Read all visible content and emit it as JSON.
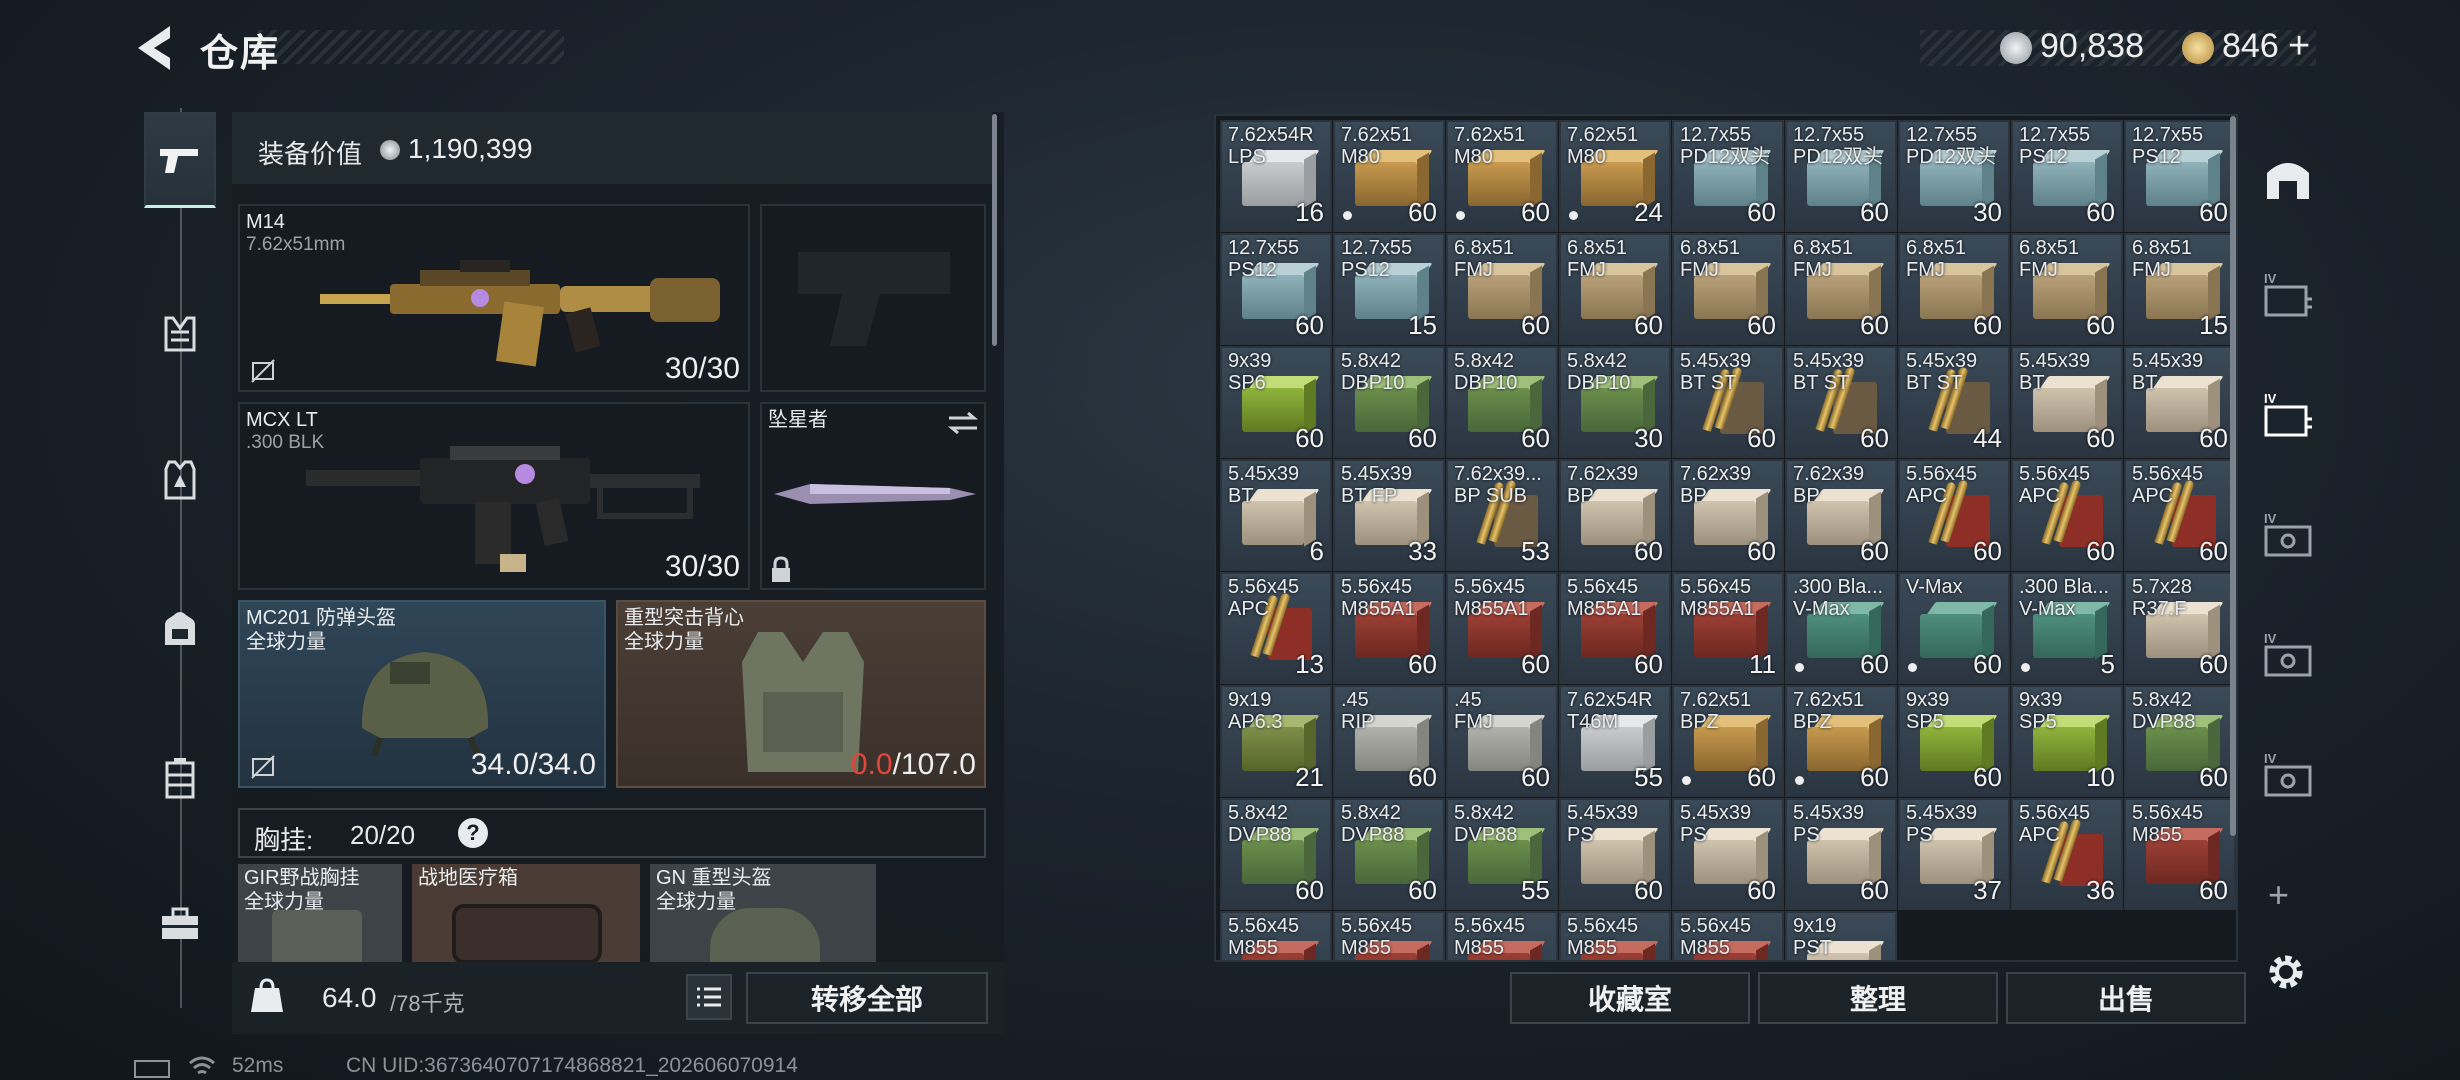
{
  "header": {
    "title": "仓库"
  },
  "currency": {
    "silver": "90,838",
    "gold": "846",
    "gold_add": "+"
  },
  "nav": [
    "pistol-icon",
    "vest-icon",
    "armor-icon",
    "backpack-icon",
    "container-icon",
    "toolbox-icon"
  ],
  "loadout": {
    "value_label": "装备价值",
    "value": "1,190,399",
    "primary": {
      "name": "M14",
      "caliber": "7.62x51mm",
      "ammo": "30/30"
    },
    "secondary": {
      "name": "MCX LT",
      "caliber": ".300 BLK",
      "ammo": "30/30"
    },
    "melee": {
      "name": "坠星者"
    },
    "helmet": {
      "name": "MC201 防弹头盔",
      "brand": "全球力量",
      "durability": "34.0/34.0"
    },
    "vest": {
      "name": "重型突击背心",
      "brand": "全球力量",
      "durability_cur": "0.0",
      "durability_max": "/107.0"
    },
    "rig": {
      "label": "胸挂:",
      "count": "20/20",
      "help": "?"
    },
    "rig_items": [
      {
        "name": "GIR野战胸挂",
        "brand": "全球力量"
      },
      {
        "name": "战地医疗箱",
        "brand": ""
      },
      {
        "name": "GN 重型头盔",
        "brand": "全球力量"
      }
    ],
    "weight": "64.0",
    "weight_max": "/78千克",
    "transfer_all": "转移全部"
  },
  "stash_items": [
    {
      "n": "7.62x54R\nLPS",
      "q": "16",
      "c": "white",
      "d": false
    },
    {
      "n": "7.62x51\nM80",
      "q": "60",
      "c": "tan",
      "d": true
    },
    {
      "n": "7.62x51\nM80",
      "q": "60",
      "c": "tan",
      "d": true
    },
    {
      "n": "7.62x51\nM80",
      "q": "24",
      "c": "tan",
      "d": true
    },
    {
      "n": "12.7x55\nPD12双头",
      "q": "60",
      "c": "blue",
      "d": false
    },
    {
      "n": "12.7x55\nPD12双头",
      "q": "60",
      "c": "blue",
      "d": false
    },
    {
      "n": "12.7x55\nPD12双头",
      "q": "30",
      "c": "blue",
      "d": false
    },
    {
      "n": "12.7x55\nPS12",
      "q": "60",
      "c": "blue",
      "d": false
    },
    {
      "n": "12.7x55\nPS12",
      "q": "60",
      "c": "blue",
      "d": false
    },
    {
      "n": "12.7x55\nPS12",
      "q": "60",
      "c": "blue",
      "d": false
    },
    {
      "n": "12.7x55\nPS12",
      "q": "15",
      "c": "blue",
      "d": false
    },
    {
      "n": "6.8x51\nFMJ",
      "q": "60",
      "c": "sand",
      "d": false
    },
    {
      "n": "6.8x51\nFMJ",
      "q": "60",
      "c": "sand",
      "d": false
    },
    {
      "n": "6.8x51\nFMJ",
      "q": "60",
      "c": "sand",
      "d": false
    },
    {
      "n": "6.8x51\nFMJ",
      "q": "60",
      "c": "sand",
      "d": false
    },
    {
      "n": "6.8x51\nFMJ",
      "q": "60",
      "c": "sand",
      "d": false
    },
    {
      "n": "6.8x51\nFMJ",
      "q": "60",
      "c": "sand",
      "d": false
    },
    {
      "n": "6.8x51\nFMJ",
      "q": "15",
      "c": "sand",
      "d": false
    },
    {
      "n": "9x39\nSP6",
      "q": "60",
      "c": "lime",
      "d": false
    },
    {
      "n": "5.8x42\nDBP10",
      "q": "60",
      "c": "green",
      "d": false
    },
    {
      "n": "5.8x42\nDBP10",
      "q": "60",
      "c": "green",
      "d": false
    },
    {
      "n": "5.8x42\nDBP10",
      "q": "30",
      "c": "green",
      "d": false
    },
    {
      "n": "5.45x39\nBT ST",
      "q": "60",
      "c": "bullet",
      "d": false
    },
    {
      "n": "5.45x39\nBT ST",
      "q": "60",
      "c": "bullet",
      "d": false
    },
    {
      "n": "5.45x39\nBT ST",
      "q": "44",
      "c": "bullet",
      "d": false
    },
    {
      "n": "5.45x39\nBT",
      "q": "60",
      "c": "beige",
      "d": false
    },
    {
      "n": "5.45x39\nBT",
      "q": "60",
      "c": "beige",
      "d": false
    },
    {
      "n": "5.45x39\nBT",
      "q": "6",
      "c": "beige",
      "d": false
    },
    {
      "n": "5.45x39\nBT FP",
      "q": "33",
      "c": "beige",
      "d": false
    },
    {
      "n": "7.62x39...\nBP SUB",
      "q": "53",
      "c": "bullet",
      "d": false
    },
    {
      "n": "7.62x39\nBP",
      "q": "60",
      "c": "beige",
      "d": false
    },
    {
      "n": "7.62x39\nBP",
      "q": "60",
      "c": "beige",
      "d": false
    },
    {
      "n": "7.62x39\nBP",
      "q": "60",
      "c": "beige",
      "d": false
    },
    {
      "n": "5.56x45\nAPC",
      "q": "60",
      "c": "redbullet",
      "d": false
    },
    {
      "n": "5.56x45\nAPC",
      "q": "60",
      "c": "redbullet",
      "d": false
    },
    {
      "n": "5.56x45\nAPC",
      "q": "60",
      "c": "redbullet",
      "d": false
    },
    {
      "n": "5.56x45\nAPC",
      "q": "13",
      "c": "redbullet",
      "d": false
    },
    {
      "n": "5.56x45\nM855A1",
      "q": "60",
      "c": "red",
      "d": false
    },
    {
      "n": "5.56x45\nM855A1",
      "q": "60",
      "c": "red",
      "d": false
    },
    {
      "n": "5.56x45\nM855A1",
      "q": "60",
      "c": "red",
      "d": false
    },
    {
      "n": "5.56x45\nM855A1",
      "q": "11",
      "c": "red",
      "d": false
    },
    {
      "n": ".300 Bla...\nV-Max",
      "q": "60",
      "c": "teal",
      "d": true
    },
    {
      "n": "V-Max",
      "q": "60",
      "c": "teal",
      "d": true
    },
    {
      "n": ".300 Bla...\nV-Max",
      "q": "5",
      "c": "teal",
      "d": true
    },
    {
      "n": "5.7x28\nR37.F",
      "q": "60",
      "c": "beige",
      "d": false
    },
    {
      "n": "9x19\nAP6.3",
      "q": "21",
      "c": "olive",
      "d": false
    },
    {
      "n": ".45\nRIP",
      "q": "60",
      "c": "grey",
      "d": false
    },
    {
      "n": ".45\nFMJ",
      "q": "60",
      "c": "grey",
      "d": false
    },
    {
      "n": "7.62x54R\nT46M",
      "q": "55",
      "c": "white",
      "d": false
    },
    {
      "n": "7.62x51\nBPZ",
      "q": "60",
      "c": "tan",
      "d": true
    },
    {
      "n": "7.62x51\nBPZ",
      "q": "60",
      "c": "tan",
      "d": true
    },
    {
      "n": "9x39\nSP5",
      "q": "60",
      "c": "lime",
      "d": false
    },
    {
      "n": "9x39\nSP5",
      "q": "10",
      "c": "lime",
      "d": false
    },
    {
      "n": "5.8x42\nDVP88",
      "q": "60",
      "c": "green",
      "d": false
    },
    {
      "n": "5.8x42\nDVP88",
      "q": "60",
      "c": "green",
      "d": false
    },
    {
      "n": "5.8x42\nDVP88",
      "q": "60",
      "c": "green",
      "d": false
    },
    {
      "n": "5.8x42\nDVP88",
      "q": "55",
      "c": "green",
      "d": false
    },
    {
      "n": "5.45x39\nPS",
      "q": "60",
      "c": "beige",
      "d": false
    },
    {
      "n": "5.45x39\nPS",
      "q": "60",
      "c": "beige",
      "d": false
    },
    {
      "n": "5.45x39\nPS",
      "q": "60",
      "c": "beige",
      "d": false
    },
    {
      "n": "5.45x39\nPS",
      "q": "37",
      "c": "beige",
      "d": false
    },
    {
      "n": "5.56x45\nAPC",
      "q": "36",
      "c": "redbullet",
      "d": false
    },
    {
      "n": "5.56x45\nM855",
      "q": "60",
      "c": "red",
      "d": false
    },
    {
      "n": "5.56x45\nM855",
      "q": "",
      "c": "red",
      "d": false
    },
    {
      "n": "5.56x45\nM855",
      "q": "",
      "c": "red",
      "d": false
    },
    {
      "n": "5.56x45\nM855",
      "q": "",
      "c": "red",
      "d": false
    },
    {
      "n": "5.56x45\nM855",
      "q": "",
      "c": "red",
      "d": false
    },
    {
      "n": "5.56x45\nM855",
      "q": "",
      "c": "red",
      "d": false
    },
    {
      "n": "9x19\nPST",
      "q": "",
      "c": "beige",
      "d": false
    }
  ],
  "actions": {
    "collection": "收藏室",
    "organize": "整理",
    "sell": "出售"
  },
  "sidebar": {
    "add": "+"
  },
  "status": {
    "ping": "52ms",
    "uid": "CN UID:3673640707174868821_202606070914"
  },
  "colors": {
    "accent": "#c9f0e8",
    "durability_broken": "#e2463b",
    "ammo_palette": {
      "tan": [
        "#c79a4e",
        "#e2bf7a",
        "#8a6630"
      ],
      "white": [
        "#c9cbcd",
        "#e6e8ea",
        "#9b9ea1"
      ],
      "blue": [
        "#8fb2bb",
        "#b9d1d6",
        "#5f8189"
      ],
      "sand": [
        "#b9a27a",
        "#d8c49d",
        "#8a7553"
      ],
      "lime": [
        "#8fb43d",
        "#c2dc78",
        "#5e7a22"
      ],
      "green": [
        "#6b8f4c",
        "#9fc07b",
        "#49673a"
      ],
      "beige": [
        "#cfc3ae",
        "#ebe2d2",
        "#9d917d"
      ],
      "red": [
        "#9b3f35",
        "#c66b5f",
        "#6c2821"
      ],
      "teal": [
        "#4f8f7d",
        "#7fb8a7",
        "#34685a"
      ],
      "grey": [
        "#b2b2ad",
        "#d6d6d1",
        "#85857f"
      ],
      "olive": [
        "#7f8f4a",
        "#a8b772",
        "#56652b"
      ]
    }
  }
}
